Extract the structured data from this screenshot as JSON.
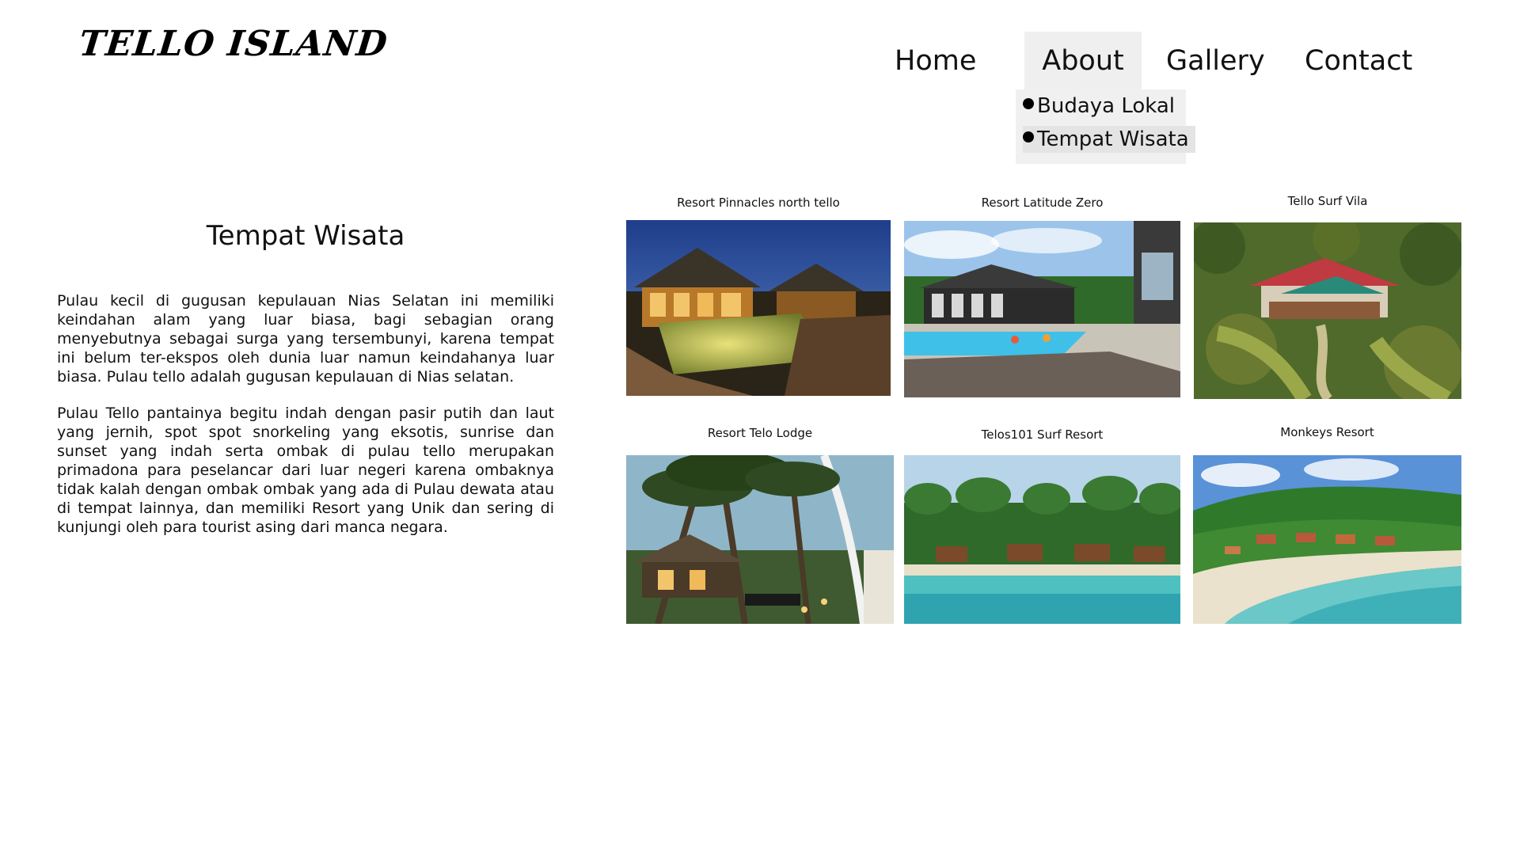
{
  "header": {
    "logo": "TELLO ISLAND",
    "nav": {
      "home": "Home",
      "about": "About",
      "gallery": "Gallery",
      "contact": "Contact"
    },
    "about_dropdown": {
      "items": [
        "Budaya Lokal",
        "Tempat Wisata"
      ],
      "highlighted": "Tempat Wisata"
    }
  },
  "main": {
    "title": "Tempat Wisata",
    "paragraphs": [
      "Pulau kecil di gugusan kepulauan Nias Selatan ini memiliki keindahan alam yang luar biasa, bagi sebagian orang menyebutnya sebagai surga yang tersembunyi, karena tempat ini belum ter-ekspos oleh dunia luar namun keindahanya luar biasa. Pulau tello adalah gugusan kepulauan di Nias selatan.",
      "Pulau Tello pantainya begitu indah dengan pasir putih dan laut yang jernih, spot spot snorkeling yang eksotis, sunrise dan sunset yang indah serta ombak di pulau tello merupakan primadona para peselancar dari luar negeri karena ombaknya tidak kalah dengan ombak ombak yang ada di Pulau dewata atau di tempat lainnya, dan memiliki Resort yang Unik dan sering di kunjungi oleh para tourist asing dari manca negara."
    ]
  },
  "gallery": {
    "items": [
      {
        "name": "Resort Pinnacles north tello"
      },
      {
        "name": "Resort Latitude Zero"
      },
      {
        "name": "Tello Surf Vila"
      },
      {
        "name": "Resort Telo Lodge"
      },
      {
        "name": "Telos101 Surf Resort"
      },
      {
        "name": "Monkeys Resort"
      }
    ]
  },
  "colors": {
    "background": "#ffffff",
    "text": "#111111",
    "nav_active_bg": "#efefef",
    "dropdown_bg": "#f0f0f0",
    "dropdown_highlight_bg": "#e4e4e4"
  }
}
